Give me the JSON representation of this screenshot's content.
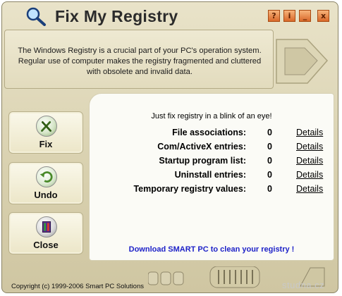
{
  "window": {
    "title": "Fix My Registry",
    "buttons": {
      "help": "?",
      "info": "i",
      "minimize": "_",
      "close": "x"
    }
  },
  "description": "The Windows Registry is a crucial part of your PC's operation system. Regular use of computer makes the registry fragmented and cluttered with obsolete and invalid data.",
  "sidebar": {
    "items": [
      {
        "label": "Fix",
        "icon": "tools-icon"
      },
      {
        "label": "Undo",
        "icon": "undo-icon"
      },
      {
        "label": "Close",
        "icon": "close-icon"
      }
    ]
  },
  "main": {
    "tagline": "Just fix registry in a blink of an eye!",
    "rows": [
      {
        "label": "File associations:",
        "count": "0",
        "link": "Details"
      },
      {
        "label": "Com/ActiveX entries:",
        "count": "0",
        "link": "Details"
      },
      {
        "label": "Startup program list:",
        "count": "0",
        "link": "Details"
      },
      {
        "label": "Uninstall entries:",
        "count": "0",
        "link": "Details"
      },
      {
        "label": "Temporary registry values:",
        "count": "0",
        "link": "Details"
      }
    ],
    "download_link": "Download SMART PC to clean your registry !"
  },
  "footer": {
    "copyright": "Copyright (c) 1999-2006 Smart PC Solutions",
    "watermark": "studna.cz"
  },
  "colors": {
    "shell": "#d8d0ae",
    "title_button": "#d9692a",
    "download_link": "#1e22c8",
    "panel": "#fbfbf6"
  }
}
